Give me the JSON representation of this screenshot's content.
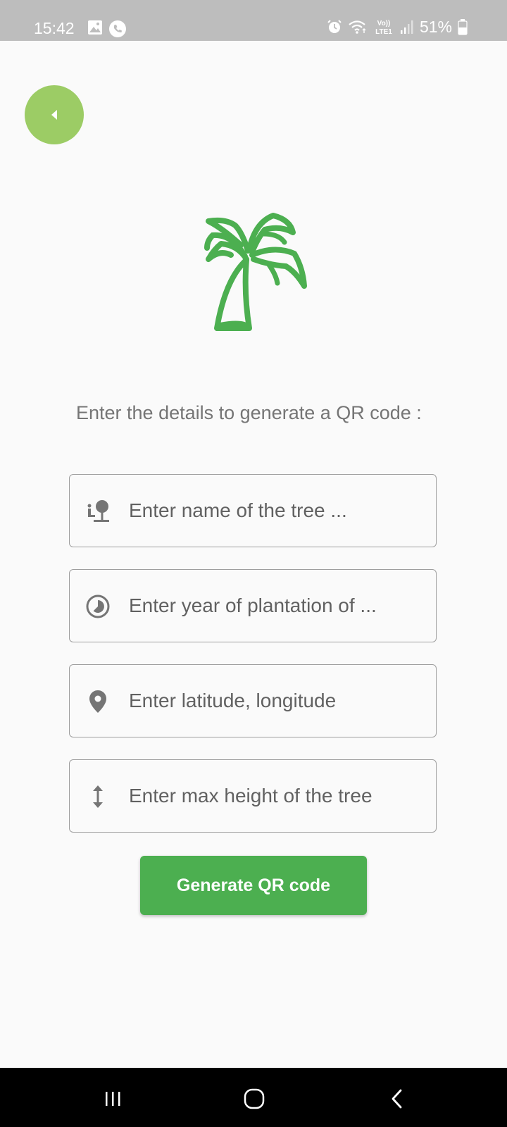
{
  "status_bar": {
    "time": "15:42",
    "left_icons": [
      "image-icon",
      "phone-call-icon"
    ],
    "right_icons": [
      "alarm-icon",
      "wifi-icon",
      "volte-lte-icon",
      "signal-icon",
      "battery-icon"
    ],
    "volte_label": "Vo))",
    "lte_label": "LTE1",
    "battery": "51%"
  },
  "header": {
    "back_icon": "back-triangle-icon"
  },
  "logo": {
    "icon": "palm-tree-icon",
    "color": "#4caf50"
  },
  "form": {
    "instruction": "Enter the details to generate a QR code :",
    "fields": [
      {
        "icon": "tree-person-icon",
        "placeholder": "Enter name of the tree ..."
      },
      {
        "icon": "timelapse-icon",
        "placeholder": "Enter year of plantation of ..."
      },
      {
        "icon": "location-pin-icon",
        "placeholder": "Enter latitude, longitude"
      },
      {
        "icon": "vertical-arrows-icon",
        "placeholder": "Enter max height of the tree"
      }
    ],
    "submit_label": "Generate QR code"
  },
  "colors": {
    "accent": "#4caf50",
    "back_button": "#9ccc65",
    "status_bar": "#bdbdbd",
    "background": "#fafafa"
  },
  "nav_bar": {
    "items": [
      "recent-apps-icon",
      "home-icon",
      "back-icon"
    ]
  }
}
